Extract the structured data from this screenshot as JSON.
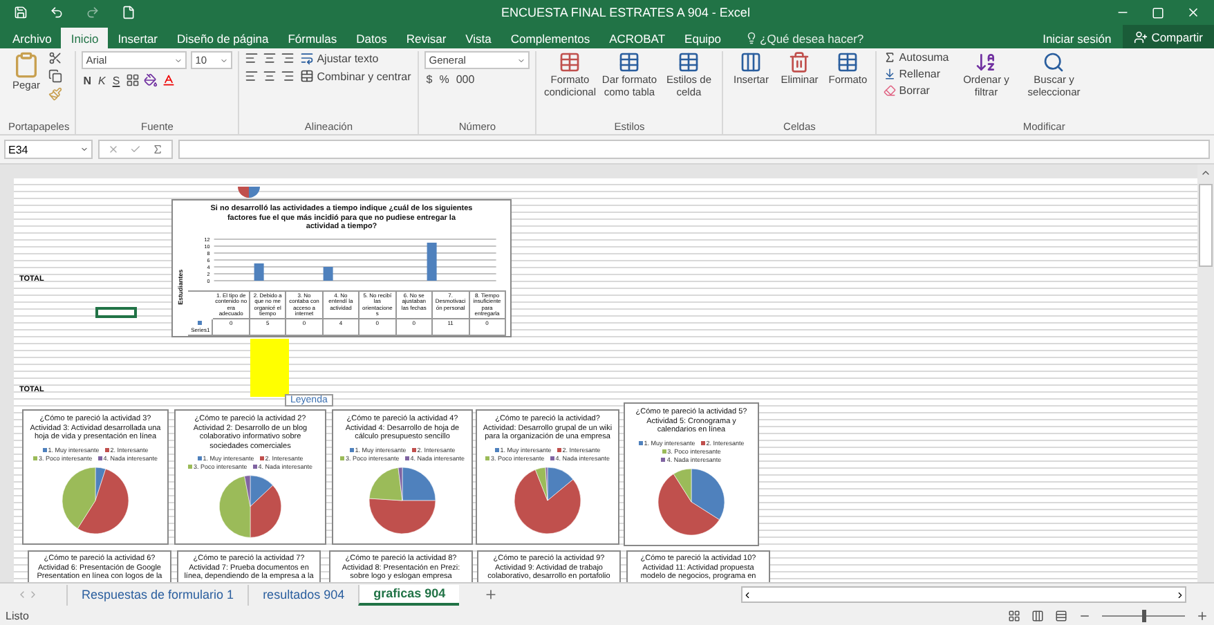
{
  "title_bar": {
    "title": "ENCUESTA FINAL ESTRATES A 904 - Excel"
  },
  "menu_tabs": [
    {
      "label": "Archivo",
      "selected": false
    },
    {
      "label": "Inicio",
      "selected": true
    },
    {
      "label": "Insertar",
      "selected": false
    },
    {
      "label": "Diseño de página",
      "selected": false
    },
    {
      "label": "Fórmulas",
      "selected": false
    },
    {
      "label": "Datos",
      "selected": false
    },
    {
      "label": "Revisar",
      "selected": false
    },
    {
      "label": "Vista",
      "selected": false
    },
    {
      "label": "Complementos",
      "selected": false
    },
    {
      "label": "ACROBAT",
      "selected": false
    },
    {
      "label": "Equipo",
      "selected": false
    }
  ],
  "tell_me": {
    "placeholder": "¿Qué desea hacer?"
  },
  "account": {
    "sign_in": "Iniciar sesión",
    "share": "Compartir"
  },
  "ribbon": {
    "clipboard": {
      "paste": "Pegar",
      "label": "Portapapeles"
    },
    "font": {
      "name": "Arial",
      "size": "10",
      "bold": "N",
      "italic": "K",
      "underline": "S",
      "label": "Fuente"
    },
    "alignment": {
      "wrap": "Ajustar texto",
      "merge": "Combinar y centrar",
      "label": "Alineación"
    },
    "number": {
      "format": "General",
      "currency": "$",
      "percent": "%",
      "thousands": "000",
      "label": "Número"
    },
    "styles": {
      "buttons": [
        "Formato condicional",
        "Dar formato como tabla",
        "Estilos de celda"
      ],
      "label": "Estilos"
    },
    "cells": {
      "buttons": [
        "Insertar",
        "Eliminar",
        "Formato"
      ],
      "label": "Celdas"
    },
    "editing": {
      "autosum": "Autosuma",
      "fill": "Rellenar",
      "clear": "Borrar",
      "buttons": [
        "Ordenar y filtrar",
        "Buscar y seleccionar"
      ],
      "label": "Modificar"
    }
  },
  "formula_bar": {
    "name_box": "E34"
  },
  "sheet": {
    "totals": [
      "TOTAL",
      "TOTAL"
    ],
    "tooltip": "Leyenda",
    "bar_chart": {
      "chart_data": {
        "type": "bar",
        "title": "Si no desarrolló las actividades a tiempo indique ¿cuál de los siguientes factores fue el que más incidió para que no pudiese entregar la actividad a tiempo?",
        "ylabel": "Estudiantes",
        "categories": [
          "1. El tipo de contenido no era adecuado",
          "2. Debido a que no me organicé el tiempo",
          "3. No contaba con acceso a internet",
          "4. No entendí la actividad",
          "5. No recibí las orientaciones",
          "6. No se ajustaban las fechas",
          "7. Desmotivación personal",
          "8. Tiempo insuficiente para entregarla"
        ],
        "series": [
          {
            "name": "Series1",
            "color": "#4f81bd",
            "values": [
              0,
              5,
              0,
              4,
              0,
              0,
              11,
              0
            ]
          }
        ],
        "ylim": [
          0,
          12
        ],
        "yticks": [
          0,
          2,
          4,
          6,
          8,
          10,
          12
        ],
        "grid": true,
        "data_labels": true
      }
    },
    "pie_charts": [
      {
        "chart_data": {
          "type": "pie",
          "title": "¿Cómo te pareció la actividad 3? Actividad 3: Actividad desarrollada una hoja de vida y presentación en línea",
          "categories": [
            "1. Muy interesante",
            "2. Interesante",
            "3. Poco interesante",
            "4. Nada interesante"
          ],
          "values": [
            5,
            54,
            41,
            0
          ],
          "legend": "top"
        }
      },
      {
        "chart_data": {
          "type": "pie",
          "title": "¿Cómo te pareció la actividad 2? Actividad 2: Desarrollo de un blog colaborativo informativo sobre sociedades comerciales",
          "categories": [
            "1. Muy interesante",
            "2. Interesante",
            "3. Poco interesante",
            "4. Nada interesante"
          ],
          "values": [
            13,
            37,
            47,
            3
          ],
          "legend": "top"
        }
      },
      {
        "chart_data": {
          "type": "pie",
          "title": "¿Cómo te pareció la actividad 4? Actividad 4: Desarrollo de hoja de cálculo presupuesto sencillo",
          "categories": [
            "1. Muy interesante",
            "2. Interesante",
            "3. Poco interesante",
            "4. Nada interesante"
          ],
          "values": [
            25,
            51,
            22,
            2
          ],
          "legend": "top"
        }
      },
      {
        "chart_data": {
          "type": "pie",
          "title": "¿Cómo te pareció la actividad? Actividad: Desarrollo grupal de un wiki para la organización de una empresa",
          "categories": [
            "1. Muy interesante",
            "2. Interesante",
            "3. Poco interesante",
            "4. Nada interesante"
          ],
          "values": [
            14,
            80,
            5,
            1
          ],
          "legend": "top"
        }
      },
      {
        "chart_data": {
          "type": "pie",
          "title": "¿Cómo te pareció la actividad 5? Actividad 5: Cronograma y calendarios en línea",
          "categories": [
            "1. Muy interesante",
            "2. Interesante",
            "3. Poco interesante",
            "4. Nada interesante"
          ],
          "values": [
            34,
            57,
            9,
            0
          ],
          "legend": "top"
        }
      }
    ],
    "partial_charts": [
      {
        "title": "¿Cómo te pareció la actividad 6? Actividad 6: Presentación de Google Presentation en línea con logos de la"
      },
      {
        "title": "¿Cómo te pareció la actividad 7? Actividad 7: Prueba documentos en línea, dependiendo de la empresa a la"
      },
      {
        "title": "¿Cómo te pareció la actividad 8? Actividad 8: Presentación en Prezi: sobre logo y eslogan empresa"
      },
      {
        "title": "¿Cómo te pareció la actividad 9? Actividad 9: Actividad de trabajo colaborativo, desarrollo en portafolio"
      },
      {
        "title": "¿Cómo te pareció la actividad 10? Actividad 11: Actividad propuesta modelo de negocios, programa en"
      }
    ]
  },
  "sheet_tabs": [
    {
      "label": "Respuestas de formulario 1",
      "selected": false
    },
    {
      "label": "resultados 904",
      "selected": false
    },
    {
      "label": "graficas 904",
      "selected": true
    }
  ],
  "status_bar": {
    "status": "Listo",
    "zoom": {
      "level": 0.5
    }
  }
}
